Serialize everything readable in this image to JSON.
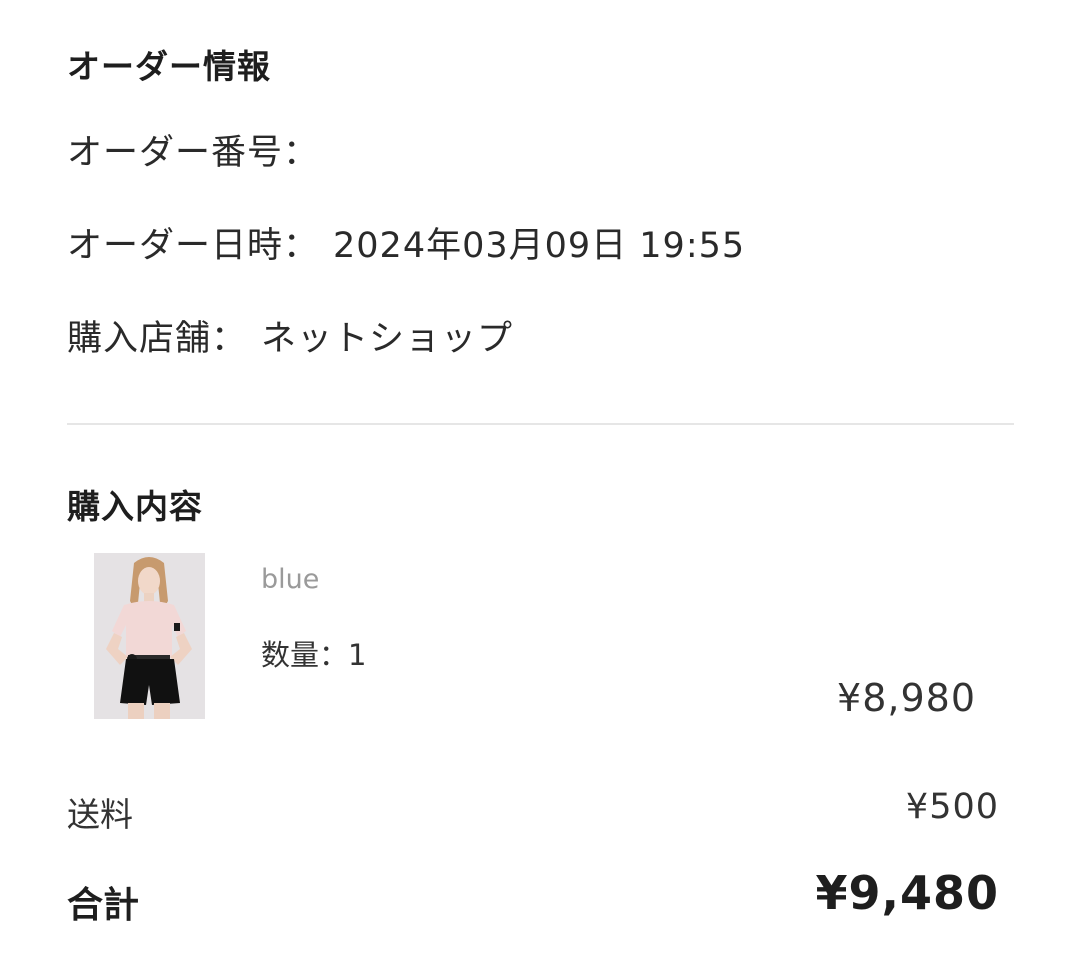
{
  "order_info": {
    "title": "オーダー情報",
    "order_number": {
      "label": "オーダー番号：",
      "value": ""
    },
    "order_datetime": {
      "label": "オーダー日時：",
      "value": "2024年03月09日 19:55"
    },
    "store": {
      "label": "購入店舗：",
      "value": "ネットショップ"
    }
  },
  "purchase": {
    "title": "購入内容",
    "items": [
      {
        "variant": "blue",
        "quantity_label": "数量：1",
        "price": "¥8,980",
        "image_icon": "product-photo"
      }
    ]
  },
  "summary": {
    "shipping_label": "送料",
    "shipping_value": "¥500",
    "total_label": "合計",
    "total_value": "¥9,480"
  }
}
